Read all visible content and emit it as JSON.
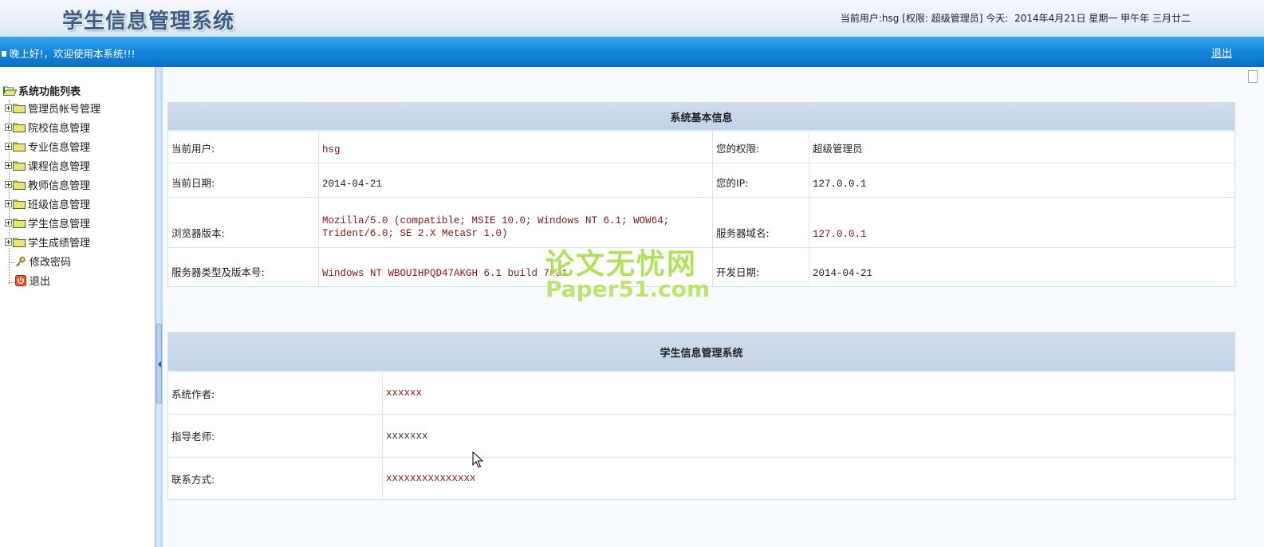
{
  "header": {
    "app_title": "学生信息管理系统",
    "current_user_text": "当前用户:hsg [权限: 超级管理员] 今天:",
    "date_text": "2014年4月21日 星期一 甲午年 三月廿二"
  },
  "topbar": {
    "greeting": "晚上好!，欢迎使用本系统!!!",
    "logout": "退出"
  },
  "sidebar": {
    "root_label": "系统功能列表",
    "items": [
      {
        "label": "管理员帐号管理"
      },
      {
        "label": "院校信息管理"
      },
      {
        "label": "专业信息管理"
      },
      {
        "label": "课程信息管理"
      },
      {
        "label": "教师信息管理"
      },
      {
        "label": "班级信息管理"
      },
      {
        "label": "学生信息管理"
      },
      {
        "label": "学生成绩管理"
      }
    ],
    "change_password": "修改密码",
    "logout": "退出"
  },
  "sysinfo": {
    "title": "系统基本信息",
    "rows": [
      {
        "label1": "当前用户:",
        "value1": "hsg",
        "label2": "您的权限:",
        "value2": "超级管理员"
      },
      {
        "label1": "当前日期:",
        "value1": "2014-04-21",
        "label2": "您的IP:",
        "value2": "127.0.0.1"
      },
      {
        "label1": "浏览器版本:",
        "value1": "Mozilla/5.0 (compatible; MSIE 10.0; Windows NT 6.1; WOW64; Trident/6.0; SE 2.X MetaSr 1.0)",
        "label2": "服务器域名:",
        "value2": "127.0.0.1"
      },
      {
        "label1": "服务器类型及版本号:",
        "value1": "Windows NT WBOUIHPQD47AKGH 6.1 build 7601",
        "label2": "开发日期:",
        "value2": "2014-04-21"
      }
    ]
  },
  "about": {
    "title": "学生信息管理系统",
    "rows": [
      {
        "label": "系统作者:",
        "value": "xxxxxx"
      },
      {
        "label": "指导老师:",
        "value": "xxxxxxx"
      },
      {
        "label": "联系方式:",
        "value": "xxxxxxxxxxxxxxx"
      }
    ]
  },
  "watermark": {
    "line1": "论文无忧网",
    "line2": "Paper51.com"
  },
  "colors": {
    "topbar_blue": "#1485dc",
    "value_red": "#8b1414",
    "table_header": "#c9d8ea"
  }
}
